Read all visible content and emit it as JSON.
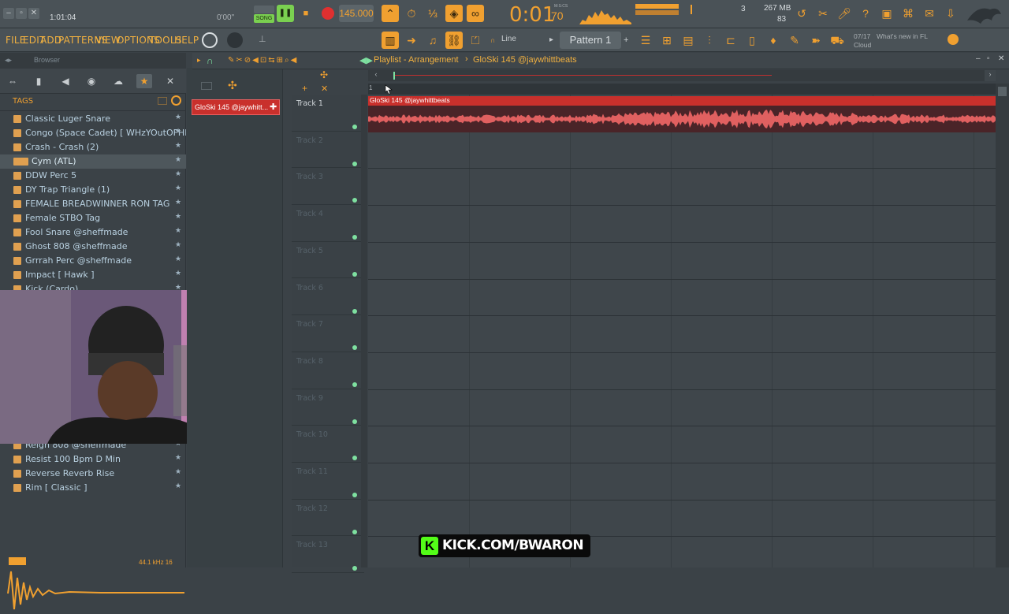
{
  "toolbar": {
    "song_position": "1:01:04",
    "hint_time": "0'00\"",
    "song_mode": "SONG",
    "tempo": "145.000",
    "time_display": "0:01",
    "time_display_small": "70",
    "time_unit": "M:S:CS",
    "cpu_count": "3",
    "memory": "267 MB",
    "polyphony": "83",
    "news_date": "07/17",
    "news_text_1": "What's new in FL",
    "news_text_2": "Cloud",
    "pattern_label": "Pattern 1",
    "snap_label": "Line",
    "accent": "#f0a030"
  },
  "menu": {
    "file": "FILE",
    "edit": "EDIT",
    "add": "ADD",
    "patterns": "PATTERNS",
    "view": "VIEW",
    "options": "OPTIONS",
    "tools": "TOOLS",
    "help": "HELP"
  },
  "browser": {
    "title": "Browser",
    "tags_label": "TAGS",
    "items": [
      {
        "label": "Classic Luger Snare"
      },
      {
        "label": "Congo (Space Cadet) [ WHzYOutOFHERE™ ]"
      },
      {
        "label": "Crash - Crash (2)"
      },
      {
        "label": "Cym (ATL)"
      },
      {
        "label": "DDW Perc 5"
      },
      {
        "label": "DY Trap Triangle (1)"
      },
      {
        "label": "FEMALE BREADWINNER RON TAG"
      },
      {
        "label": "Female STBO Tag"
      },
      {
        "label": "Fool Snare @sheffmade"
      },
      {
        "label": "Ghost 808 @sheffmade"
      },
      {
        "label": "Grrrah Perc @sheffmade"
      },
      {
        "label": "Impact [ Hawk ]"
      },
      {
        "label": "Kick (Cardo)"
      },
      {
        "label": "Reign 808 @sheffmade"
      },
      {
        "label": "Resist 100 Bpm D Min"
      },
      {
        "label": "Reverse Reverb Rise"
      },
      {
        "label": "Rim [ Classic ]"
      }
    ],
    "sample_info": "44.1 kHz 16"
  },
  "playlist": {
    "title": "Playlist - Arrangement",
    "breadcrumb_sep": "›",
    "pattern_name": "GloSki 145 @jaywhittbeats",
    "picker_clip": "GloSki 145 @jaywhitt...",
    "clip_label": "GloSki 145 @jaywhittbeats",
    "ruler_start": "1",
    "tracks": [
      "Track 1",
      "Track 2",
      "Track 3",
      "Track 4",
      "Track 5",
      "Track 6",
      "Track 7",
      "Track 8",
      "Track 9",
      "Track 10",
      "Track 11",
      "Track 12",
      "Track 13"
    ]
  },
  "overlay": {
    "kick_logo": "K",
    "kick_text": "KICK.COM/BWARON"
  }
}
